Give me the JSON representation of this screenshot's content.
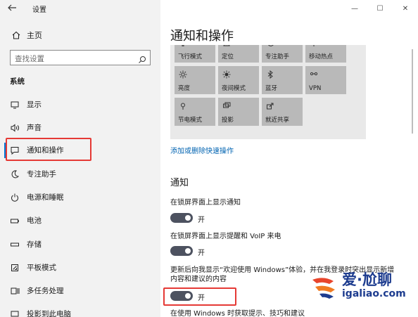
{
  "window": {
    "title": "设置",
    "controls": {
      "minimize": "—",
      "maximize": "☐",
      "close": "✕"
    }
  },
  "sidebar": {
    "home": "主页",
    "search_placeholder": "查找设置",
    "section": "系统",
    "items": [
      {
        "label": "显示",
        "icon": "monitor-icon"
      },
      {
        "label": "声音",
        "icon": "speaker-icon"
      },
      {
        "label": "通知和操作",
        "icon": "notification-icon",
        "active": true
      },
      {
        "label": "专注助手",
        "icon": "moon-icon"
      },
      {
        "label": "电源和睡眠",
        "icon": "power-icon"
      },
      {
        "label": "电池",
        "icon": "battery-icon"
      },
      {
        "label": "存储",
        "icon": "storage-icon"
      },
      {
        "label": "平板模式",
        "icon": "tablet-icon"
      },
      {
        "label": "多任务处理",
        "icon": "multitask-icon"
      },
      {
        "label": "投影到此电脑",
        "icon": "project-icon"
      }
    ]
  },
  "main": {
    "title": "通知和操作",
    "tiles": [
      {
        "label": "飞行模式",
        "icon": "airplane-icon"
      },
      {
        "label": "定位",
        "icon": "location-icon"
      },
      {
        "label": "专注助手",
        "icon": "moon-icon"
      },
      {
        "label": "移动热点",
        "icon": "hotspot-icon"
      },
      {
        "label": "亮度",
        "icon": "brightness-icon"
      },
      {
        "label": "夜间模式",
        "icon": "night-light-icon"
      },
      {
        "label": "蓝牙",
        "icon": "bluetooth-icon"
      },
      {
        "label": "VPN",
        "icon": "vpn-icon"
      },
      {
        "label": "节电模式",
        "icon": "battery-saver-icon"
      },
      {
        "label": "投影",
        "icon": "project-icon"
      },
      {
        "label": "就近共享",
        "icon": "share-icon"
      }
    ],
    "quick_actions_link": "添加或删除快速操作",
    "notifications_header": "通知",
    "settings": [
      {
        "label": "在锁屏界面上显示通知",
        "toggle": "开"
      },
      {
        "label": "在锁屏界面上显示提醒和 VoIP 来电",
        "toggle": "开"
      },
      {
        "label": "更新后向我显示“欢迎使用 Windows”体验，并在我登录时突出显示新增内容和建议的内容",
        "toggle": "开"
      },
      {
        "label": "在使用 Windows 时获取提示、技巧和建议"
      }
    ]
  },
  "watermark": {
    "title": "爱·尬聊",
    "subtitle": "igaliao.com"
  },
  "colors": {
    "accent": "#0078d7",
    "toggle_on": "#4d5260",
    "highlight": "#e53935",
    "link": "#0063b1"
  }
}
